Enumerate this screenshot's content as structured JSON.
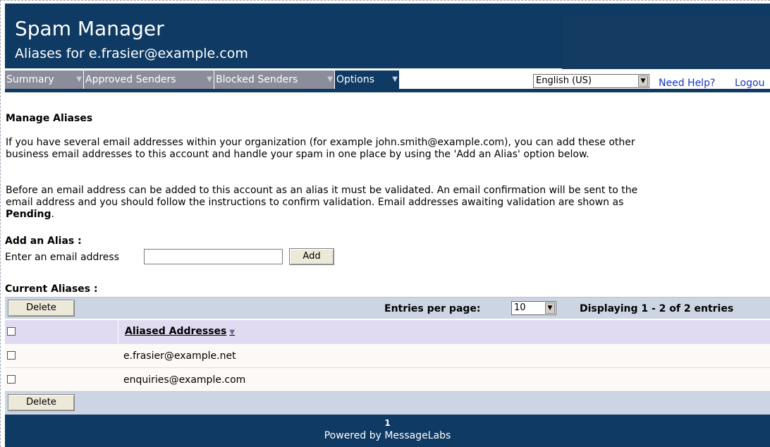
{
  "header": {
    "title": "Spam Manager",
    "subtitle": "Aliases for e.frasier@example.com"
  },
  "nav": {
    "tabs": [
      {
        "label": "Summary"
      },
      {
        "label": "Approved Senders"
      },
      {
        "label": "Blocked Senders"
      },
      {
        "label": "Options"
      }
    ],
    "language": "English (US)",
    "help_link": "Need Help?",
    "logout_link": "Logou"
  },
  "manage": {
    "heading": "Manage Aliases",
    "para1_line1": "If you have several email addresses within your organization (for example john.smith@example.com), you can add these other",
    "para1_line2": "business email addresses to this account and handle your spam in one place by using the 'Add an Alias' option below.",
    "para2_line1": "Before an email address can be added to this account as an alias it must be validated. An email confirmation will be sent to the",
    "para2_line2": "email address and you should follow the instructions to confirm validation. Email addresses awaiting validation are shown as",
    "para2_pending": "Pending",
    "para2_end": "."
  },
  "add_alias": {
    "heading": "Add an Alias :",
    "label": "Enter an email address",
    "input_value": "",
    "button": "Add"
  },
  "current": {
    "heading": "Current Aliases :",
    "delete_top": "Delete",
    "delete_bottom": "Delete",
    "entries_label": "Entries per page:",
    "entries_value": "10",
    "display_info": "Displaying 1 - 2 of 2 entries",
    "column_header": "Aliased Addresses",
    "rows": [
      {
        "address": "e.frasier@example.net"
      },
      {
        "address": "enquiries@example.com"
      }
    ]
  },
  "footer": {
    "page": "1",
    "powered": "Powered by MessageLabs"
  },
  "colors": {
    "header_bg": "#0f3a63",
    "inactive_tab": "#8c8d9b",
    "table_bar": "#ccd5e4",
    "link": "#1a33cc"
  }
}
